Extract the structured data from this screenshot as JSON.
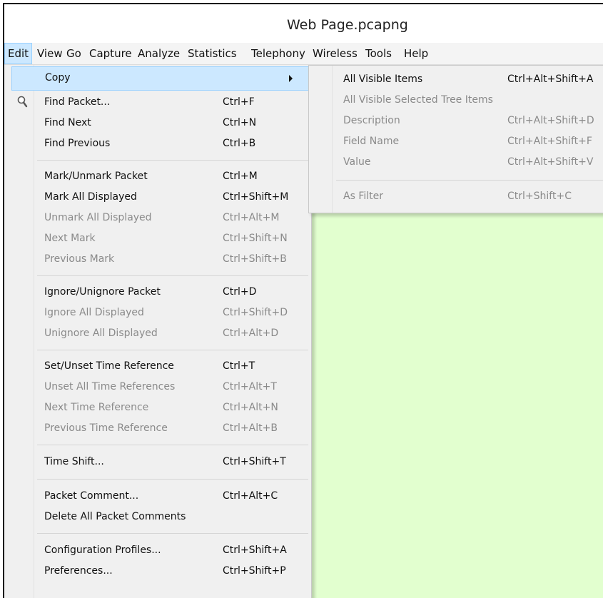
{
  "window": {
    "title": "Web Page.pcapng"
  },
  "menubar": {
    "items": [
      "Edit",
      "View",
      "Go",
      "Capture",
      "Analyze",
      "Statistics",
      "Telephony",
      "Wireless",
      "Tools",
      "Help"
    ],
    "active": "Edit"
  },
  "edit_menu": {
    "items": [
      {
        "label": "Copy",
        "shortcut": "",
        "enabled": true,
        "submenu": true,
        "highlighted": true
      },
      {
        "label": "Find Packet...",
        "shortcut": "Ctrl+F",
        "enabled": true,
        "icon": "magnifier-icon"
      },
      {
        "label": "Find Next",
        "shortcut": "Ctrl+N",
        "enabled": true
      },
      {
        "label": "Find Previous",
        "shortcut": "Ctrl+B",
        "enabled": true
      },
      {
        "label": "Mark/Unmark Packet",
        "shortcut": "Ctrl+M",
        "enabled": true
      },
      {
        "label": "Mark All Displayed",
        "shortcut": "Ctrl+Shift+M",
        "enabled": true
      },
      {
        "label": "Unmark All Displayed",
        "shortcut": "Ctrl+Alt+M",
        "enabled": false
      },
      {
        "label": "Next Mark",
        "shortcut": "Ctrl+Shift+N",
        "enabled": false
      },
      {
        "label": "Previous Mark",
        "shortcut": "Ctrl+Shift+B",
        "enabled": false
      },
      {
        "label": "Ignore/Unignore Packet",
        "shortcut": "Ctrl+D",
        "enabled": true
      },
      {
        "label": "Ignore All Displayed",
        "shortcut": "Ctrl+Shift+D",
        "enabled": false
      },
      {
        "label": "Unignore All Displayed",
        "shortcut": "Ctrl+Alt+D",
        "enabled": false
      },
      {
        "label": "Set/Unset Time Reference",
        "shortcut": "Ctrl+T",
        "enabled": true
      },
      {
        "label": "Unset All Time References",
        "shortcut": "Ctrl+Alt+T",
        "enabled": false
      },
      {
        "label": "Next Time Reference",
        "shortcut": "Ctrl+Alt+N",
        "enabled": false
      },
      {
        "label": "Previous Time Reference",
        "shortcut": "Ctrl+Alt+B",
        "enabled": false
      },
      {
        "label": "Time Shift...",
        "shortcut": "Ctrl+Shift+T",
        "enabled": true
      },
      {
        "label": "Packet Comment...",
        "shortcut": "Ctrl+Alt+C",
        "enabled": true
      },
      {
        "label": "Delete All Packet Comments",
        "shortcut": "",
        "enabled": true
      },
      {
        "label": "Configuration Profiles...",
        "shortcut": "Ctrl+Shift+A",
        "enabled": true
      },
      {
        "label": "Preferences...",
        "shortcut": "Ctrl+Shift+P",
        "enabled": true
      }
    ]
  },
  "copy_submenu": {
    "items": [
      {
        "label": "All Visible Items",
        "shortcut": "Ctrl+Alt+Shift+A",
        "enabled": true
      },
      {
        "label": "All Visible Selected Tree Items",
        "shortcut": "",
        "enabled": false
      },
      {
        "label": "Description",
        "shortcut": "Ctrl+Alt+Shift+D",
        "enabled": false
      },
      {
        "label": "Field Name",
        "shortcut": "Ctrl+Alt+Shift+F",
        "enabled": false
      },
      {
        "label": "Value",
        "shortcut": "Ctrl+Alt+Shift+V",
        "enabled": false
      },
      {
        "label": "As Filter",
        "shortcut": "Ctrl+Shift+C",
        "enabled": false
      }
    ]
  },
  "colors": {
    "highlight": "#cce8ff",
    "content_background": "#e2ffcf",
    "menu_background": "#f0f0f0",
    "disabled_text": "#8a8a8a"
  }
}
